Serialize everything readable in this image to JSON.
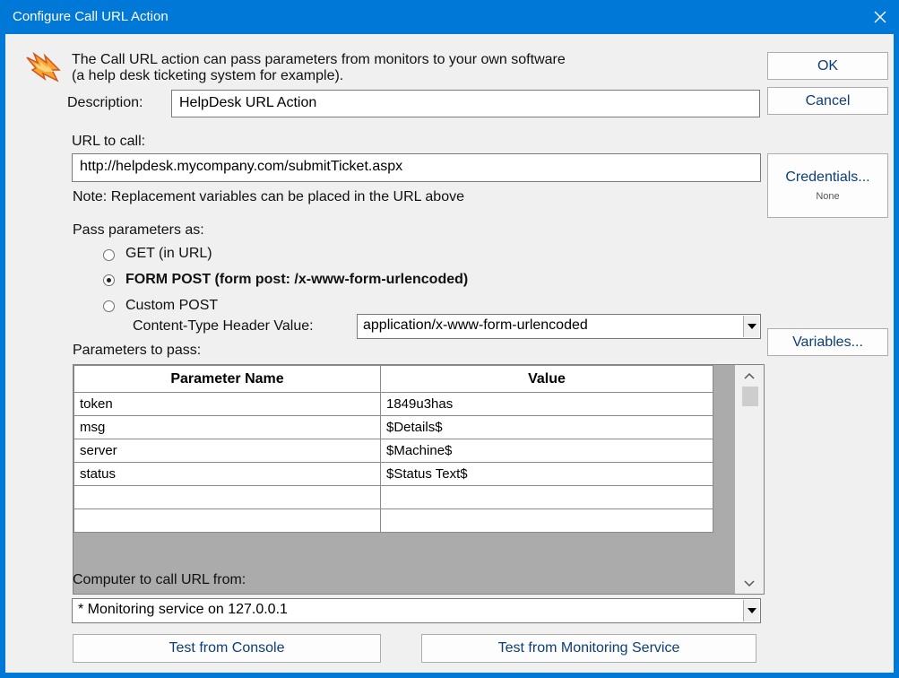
{
  "window": {
    "title": "Configure Call URL Action"
  },
  "intro": {
    "line1": "The Call URL action can pass parameters from monitors to your own software",
    "line2": "(a help desk ticketing system for example)."
  },
  "description": {
    "label": "Description:",
    "value": "HelpDesk URL Action"
  },
  "url": {
    "label": "URL to call:",
    "value": "http://helpdesk.mycompany.com/submitTicket.aspx",
    "note": "Note: Replacement variables can be placed in the URL above"
  },
  "pass_params": {
    "label": "Pass parameters as:",
    "options": [
      {
        "label": "GET (in URL)",
        "selected": false
      },
      {
        "label": "FORM POST (form post: /x-www-form-urlencoded)",
        "selected": true
      },
      {
        "label": "Custom POST",
        "selected": false
      }
    ],
    "content_type_label": "Content-Type Header Value:",
    "content_type_value": "application/x-www-form-urlencoded"
  },
  "parameters": {
    "label": "Parameters to pass:",
    "columns": [
      "Parameter Name",
      "Value"
    ],
    "rows": [
      [
        "token",
        "1849u3has"
      ],
      [
        "msg",
        "$Details$"
      ],
      [
        "server",
        "$Machine$"
      ],
      [
        "status",
        "$Status Text$"
      ],
      [
        "",
        ""
      ],
      [
        "",
        ""
      ]
    ]
  },
  "computer": {
    "label": "Computer to call URL from:",
    "value": "* Monitoring service on 127.0.0.1"
  },
  "buttons": {
    "ok": "OK",
    "cancel": "Cancel",
    "credentials": "Credentials...",
    "credentials_sub": "None",
    "variables": "Variables...",
    "test_console": "Test from Console",
    "test_service": "Test from Monitoring Service"
  },
  "colors": {
    "titlebar": "#0078d7",
    "dialog_bg": "#f0f0f0",
    "button_text": "#0c3e7a"
  }
}
